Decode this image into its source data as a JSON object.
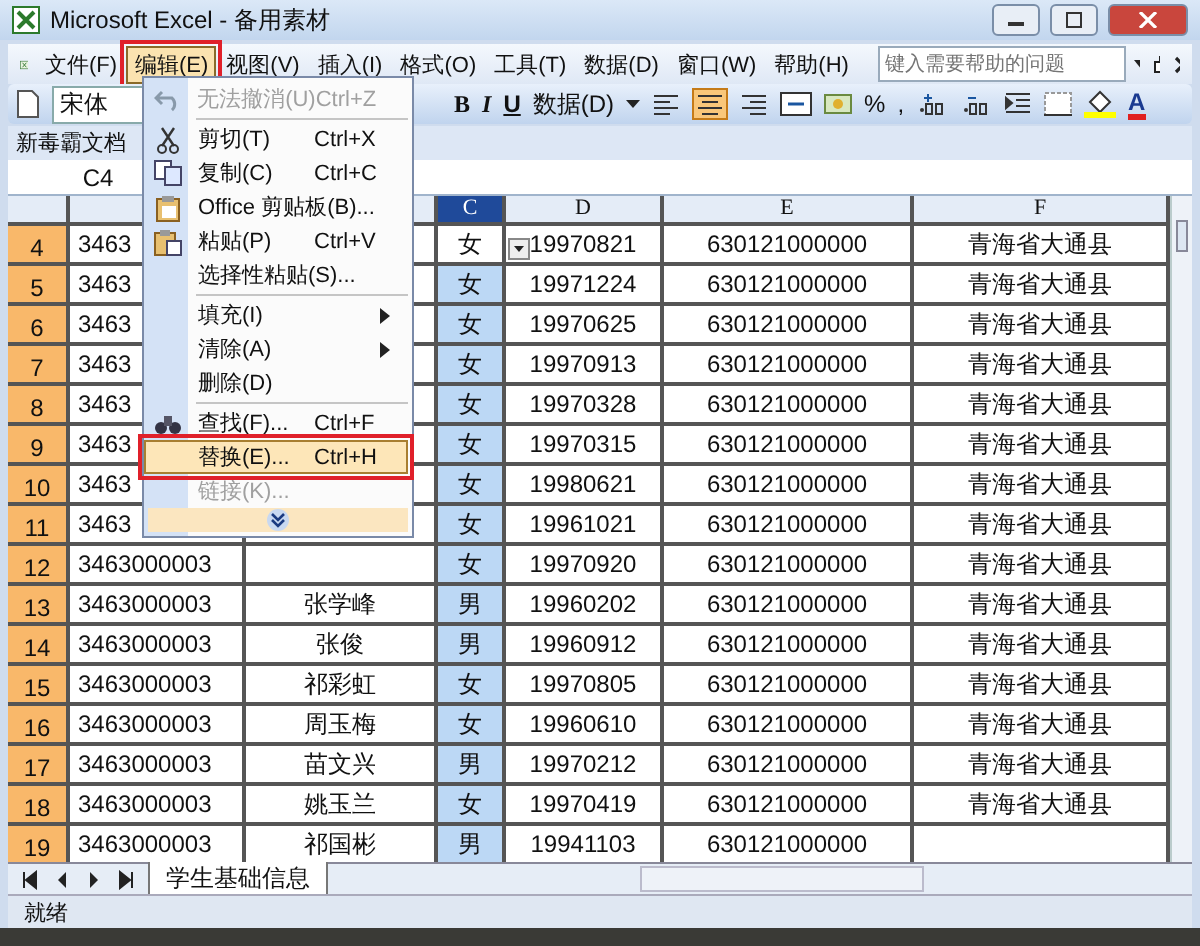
{
  "window": {
    "title": "Microsoft Excel - 备用素材"
  },
  "menus": [
    {
      "label": "文件(F)",
      "selected": false,
      "framed": false
    },
    {
      "label": "编辑(E)",
      "selected": true,
      "framed": true
    },
    {
      "label": "视图(V)",
      "selected": false,
      "framed": false
    },
    {
      "label": "插入(I)",
      "selected": false,
      "framed": false
    },
    {
      "label": "格式(O)",
      "selected": false,
      "framed": false
    },
    {
      "label": "工具(T)",
      "selected": false,
      "framed": false
    },
    {
      "label": "数据(D)",
      "selected": false,
      "framed": false
    },
    {
      "label": "窗口(W)",
      "selected": false,
      "framed": false
    },
    {
      "label": "帮助(H)",
      "selected": false,
      "framed": false
    }
  ],
  "help_box": {
    "placeholder": "键入需要帮助的问题"
  },
  "toolbar": {
    "font": "宋体",
    "bold": "B",
    "italic": "I",
    "underline": "U",
    "data_menu": "数据(D)",
    "percent": "%",
    "comma": ",",
    "font_color": "A"
  },
  "toolbar2": {
    "label": "新毒霸文档"
  },
  "name_box": "C4",
  "columns": [
    {
      "label": "C",
      "selected": true
    },
    {
      "label": "D",
      "selected": false
    },
    {
      "label": "E",
      "selected": false
    },
    {
      "label": "F",
      "selected": false
    }
  ],
  "rows": [
    {
      "num": "4",
      "selected": true,
      "active": true,
      "a": "3463",
      "c": "女",
      "d": "19970821",
      "e": "630121000000",
      "f": "青海省大通县"
    },
    {
      "num": "5",
      "selected": true,
      "active": false,
      "a": "3463",
      "c": "女",
      "d": "19971224",
      "e": "630121000000",
      "f": "青海省大通县"
    },
    {
      "num": "6",
      "selected": true,
      "active": false,
      "a": "3463",
      "c": "女",
      "d": "19970625",
      "e": "630121000000",
      "f": "青海省大通县"
    },
    {
      "num": "7",
      "selected": true,
      "active": false,
      "a": "3463",
      "c": "女",
      "d": "19970913",
      "e": "630121000000",
      "f": "青海省大通县"
    },
    {
      "num": "8",
      "selected": true,
      "active": false,
      "a": "3463",
      "c": "女",
      "d": "19970328",
      "e": "630121000000",
      "f": "青海省大通县"
    },
    {
      "num": "9",
      "selected": true,
      "active": false,
      "a": "3463",
      "c": "女",
      "d": "19970315",
      "e": "630121000000",
      "f": "青海省大通县"
    },
    {
      "num": "10",
      "selected": true,
      "active": false,
      "a": "3463",
      "c": "女",
      "d": "19980621",
      "e": "630121000000",
      "f": "青海省大通县"
    },
    {
      "num": "11",
      "selected": true,
      "active": false,
      "a": "3463",
      "c": "女",
      "d": "19961021",
      "e": "630121000000",
      "f": "青海省大通县"
    },
    {
      "num": "12",
      "selected": true,
      "active": false,
      "a": "3463000003",
      "c": "女",
      "d": "19970920",
      "e": "630121000000",
      "f": "青海省大通县"
    },
    {
      "num": "13",
      "selected": true,
      "active": false,
      "a": "3463000003",
      "b": "张学峰",
      "c": "男",
      "d": "19960202",
      "e": "630121000000",
      "f": "青海省大通县"
    },
    {
      "num": "14",
      "selected": true,
      "active": false,
      "a": "3463000003",
      "b": "张俊",
      "c": "男",
      "d": "19960912",
      "e": "630121000000",
      "f": "青海省大通县"
    },
    {
      "num": "15",
      "selected": true,
      "active": false,
      "a": "3463000003",
      "b": "祁彩虹",
      "c": "女",
      "d": "19970805",
      "e": "630121000000",
      "f": "青海省大通县"
    },
    {
      "num": "16",
      "selected": true,
      "active": false,
      "a": "3463000003",
      "b": "周玉梅",
      "c": "女",
      "d": "19960610",
      "e": "630121000000",
      "f": "青海省大通县"
    },
    {
      "num": "17",
      "selected": true,
      "active": false,
      "a": "3463000003",
      "b": "苗文兴",
      "c": "男",
      "d": "19970212",
      "e": "630121000000",
      "f": "青海省大通县"
    },
    {
      "num": "18",
      "selected": true,
      "active": false,
      "a": "3463000003",
      "b": "姚玉兰",
      "c": "女",
      "d": "19970419",
      "e": "630121000000",
      "f": "青海省大通县"
    },
    {
      "num": "19",
      "selected": true,
      "active": false,
      "a": "3463000003",
      "b": "祁国彬",
      "c": "男",
      "d": "19941103",
      "e": "630121000000"
    }
  ],
  "edit_menu": [
    {
      "kind": "undo",
      "label": "无法撤消(U)",
      "shortcut": "Ctrl+Z",
      "disabled": true,
      "highlighted": false,
      "framed": false
    },
    {
      "kind": "separator"
    },
    {
      "kind": "cut",
      "label": "剪切(T)",
      "shortcut": "Ctrl+X",
      "disabled": false,
      "highlighted": false,
      "framed": false
    },
    {
      "kind": "copy",
      "label": "复制(C)",
      "shortcut": "Ctrl+C",
      "disabled": false,
      "highlighted": false,
      "framed": false
    },
    {
      "kind": "clipboard",
      "label": "Office 剪贴板(B)...",
      "disabled": false,
      "highlighted": false,
      "framed": false
    },
    {
      "kind": "paste",
      "label": "粘贴(P)",
      "shortcut": "Ctrl+V",
      "disabled": false,
      "highlighted": false,
      "framed": false
    },
    {
      "kind": "plain",
      "label": "选择性粘贴(S)...",
      "disabled": false,
      "highlighted": false,
      "framed": false
    },
    {
      "kind": "separator"
    },
    {
      "kind": "submenu",
      "label": "填充(I)",
      "disabled": false,
      "highlighted": false,
      "framed": false
    },
    {
      "kind": "submenu",
      "label": "清除(A)",
      "disabled": false,
      "highlighted": false,
      "framed": false
    },
    {
      "kind": "plain",
      "label": "删除(D)",
      "disabled": false,
      "highlighted": false,
      "framed": false
    },
    {
      "kind": "separator"
    },
    {
      "kind": "find",
      "label": "查找(F)...",
      "shortcut": "Ctrl+F",
      "disabled": false,
      "highlighted": false,
      "framed": false
    },
    {
      "kind": "plain",
      "label": "替换(E)...",
      "shortcut": "Ctrl+H",
      "disabled": false,
      "highlighted": true,
      "framed": true
    },
    {
      "kind": "plain",
      "label": "链接(K)...",
      "disabled": true,
      "highlighted": false,
      "framed": false
    },
    {
      "kind": "more"
    }
  ],
  "sheet_tabs": [
    {
      "label": "学生基础信息",
      "selected": true
    }
  ],
  "status_bar": {
    "text": "就绪"
  }
}
